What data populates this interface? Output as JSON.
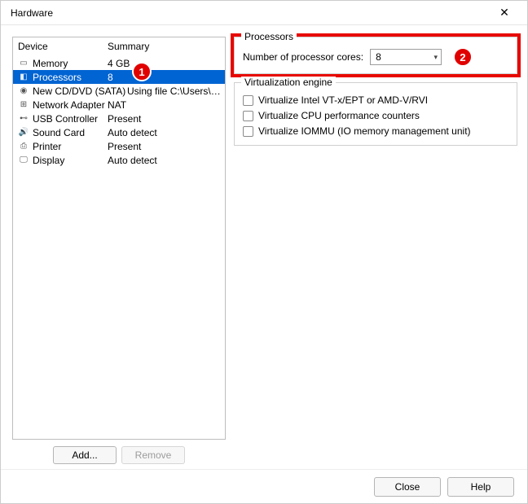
{
  "window": {
    "title": "Hardware"
  },
  "markers": {
    "one": "1",
    "two": "2"
  },
  "deviceList": {
    "headers": {
      "device": "Device",
      "summary": "Summary"
    },
    "rows": [
      {
        "icon": "memory-icon",
        "name": "Memory",
        "summary": "4 GB",
        "selected": false
      },
      {
        "icon": "processors-icon",
        "name": "Processors",
        "summary": "8",
        "selected": true
      },
      {
        "icon": "cd-icon",
        "name": "New CD/DVD (SATA)",
        "summary": "Using file C:\\Users\\codru\\De...",
        "selected": false
      },
      {
        "icon": "network-icon",
        "name": "Network Adapter",
        "summary": "NAT",
        "selected": false
      },
      {
        "icon": "usb-icon",
        "name": "USB Controller",
        "summary": "Present",
        "selected": false
      },
      {
        "icon": "sound-icon",
        "name": "Sound Card",
        "summary": "Auto detect",
        "selected": false
      },
      {
        "icon": "printer-icon",
        "name": "Printer",
        "summary": "Present",
        "selected": false
      },
      {
        "icon": "display-icon",
        "name": "Display",
        "summary": "Auto detect",
        "selected": false
      }
    ],
    "buttons": {
      "add": "Add...",
      "remove": "Remove"
    }
  },
  "processors": {
    "legend": "Processors",
    "cores_label": "Number of processor cores:",
    "cores_value": "8"
  },
  "virtualization": {
    "legend": "Virtualization engine",
    "opts": [
      "Virtualize Intel VT-x/EPT or AMD-V/RVI",
      "Virtualize CPU performance counters",
      "Virtualize IOMMU (IO memory management unit)"
    ]
  },
  "footer": {
    "close": "Close",
    "help": "Help"
  }
}
